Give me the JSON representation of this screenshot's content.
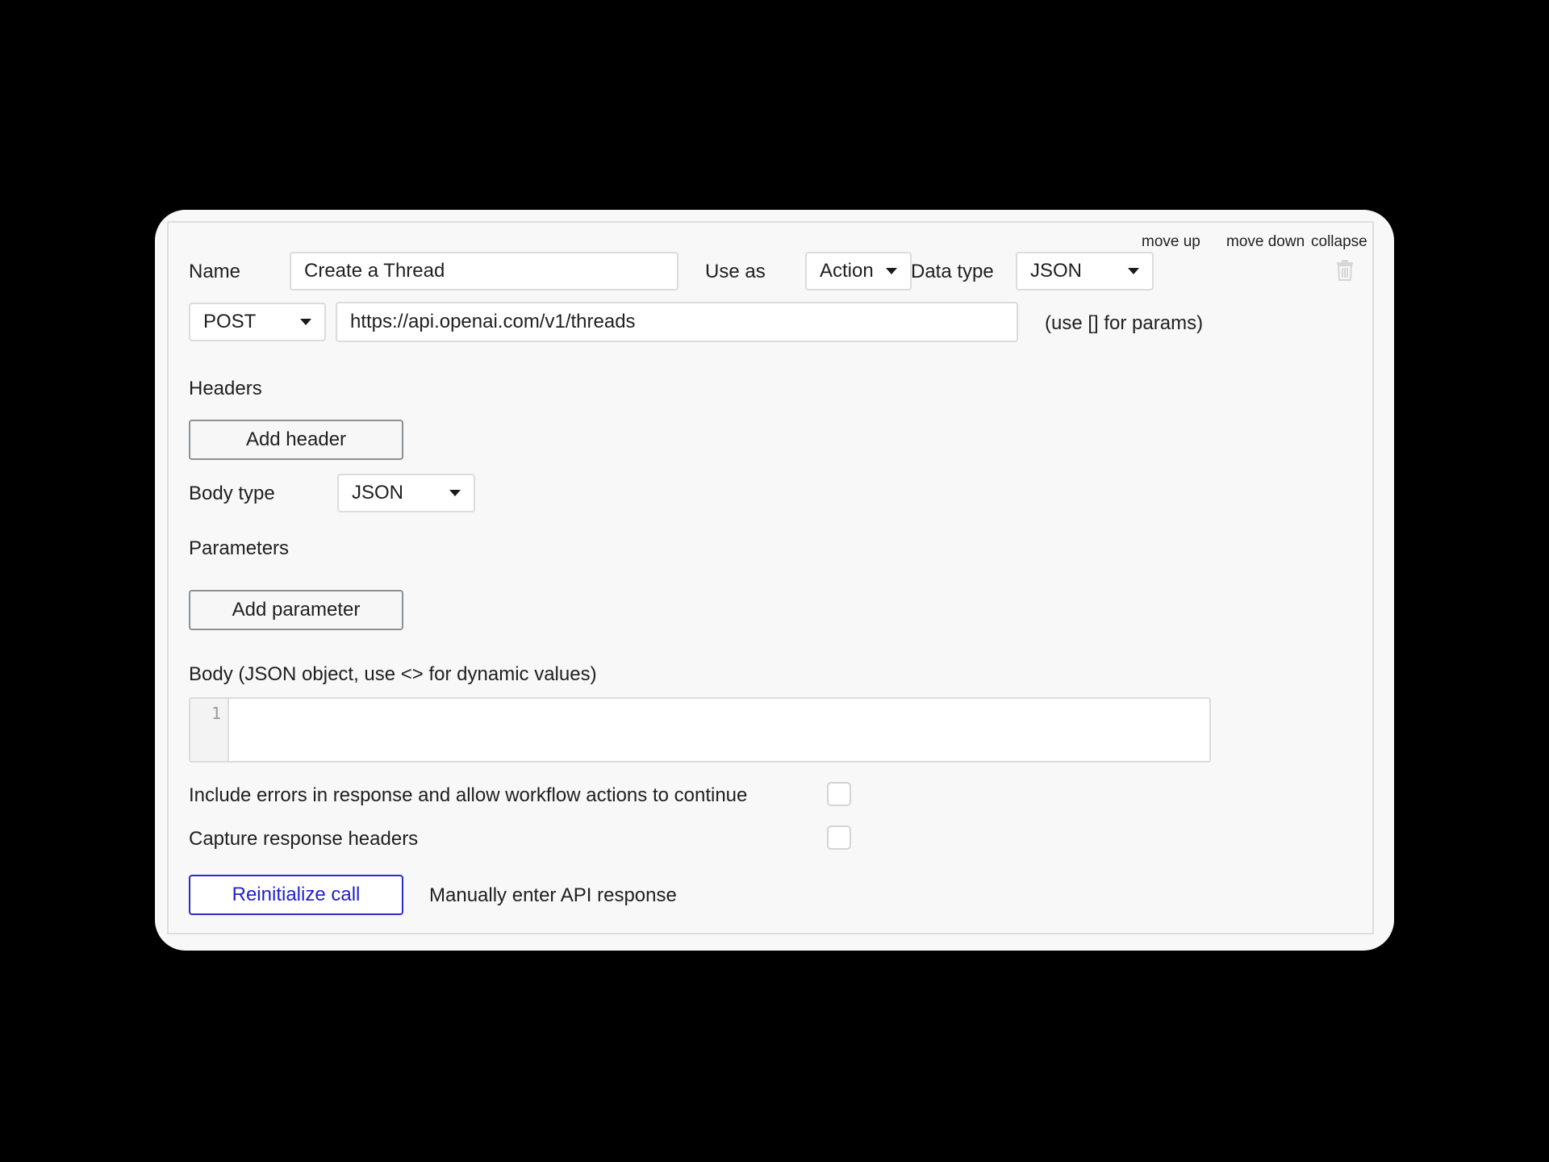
{
  "header": {
    "move_up": "move up",
    "move_down": "move down",
    "collapse": "collapse",
    "delete_icon": "trash-icon"
  },
  "call": {
    "name_label": "Name",
    "name_value": "Create a Thread",
    "use_as_label": "Use as",
    "use_as_value": "Action",
    "data_type_label": "Data type",
    "data_type_value": "JSON",
    "method_value": "POST",
    "url_value": "https://api.openai.com/v1/threads",
    "url_hint": "(use [] for params)"
  },
  "headers": {
    "title": "Headers",
    "add_button": "Add header"
  },
  "body_type": {
    "label": "Body type",
    "value": "JSON"
  },
  "parameters": {
    "title": "Parameters",
    "add_button": "Add parameter"
  },
  "body": {
    "label": "Body (JSON object, use <> for dynamic values)",
    "line_number": "1",
    "content": ""
  },
  "options": {
    "include_errors_label": "Include errors in response and allow workflow actions to continue",
    "include_errors_checked": false,
    "capture_headers_label": "Capture response headers",
    "capture_headers_checked": false
  },
  "footer": {
    "reinitialize_button": "Reinitialize call",
    "manual_response_link": "Manually enter API response"
  },
  "colors": {
    "background": "#000000",
    "card": "#f8f8f8",
    "primary_button": "#1f1fd0",
    "border": "#dcdcdc"
  }
}
